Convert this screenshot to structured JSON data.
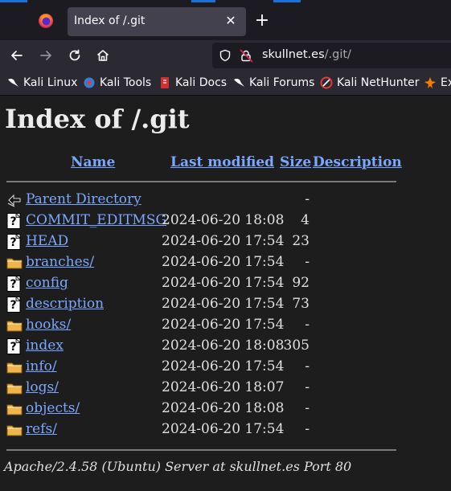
{
  "browser": {
    "tab_title": "Index of /.git",
    "tab_close": "✕",
    "new_tab": "+",
    "url_host": "skullnet.es",
    "url_path": "/.git/"
  },
  "bookmarks": [
    {
      "label": "Kali Linux",
      "icon": "kali-dragon-icon",
      "color": "#fbfbfe"
    },
    {
      "label": "Kali Tools",
      "icon": "kali-tools-icon",
      "color": "#3a7bd5"
    },
    {
      "label": "Kali Docs",
      "icon": "kali-docs-icon",
      "color": "#d32f2f"
    },
    {
      "label": "Kali Forums",
      "icon": "kali-dragon-icon",
      "color": "#fbfbfe"
    },
    {
      "label": "Kali NetHunter",
      "icon": "nethunter-icon",
      "color": "#e53935"
    },
    {
      "label": "Ex",
      "icon": "exploit-db-icon",
      "color": "#f57c00"
    }
  ],
  "page": {
    "title": "Index of /.git",
    "columns": {
      "name": "Name",
      "last_modified": "Last modified",
      "size": "Size",
      "description": "Description"
    },
    "rows": [
      {
        "name": "Parent Directory",
        "modified": "",
        "size": "-",
        "icon": "back-arrow-icon"
      },
      {
        "name": "COMMIT_EDITMSG",
        "modified": "2024-06-20 18:08",
        "size": "4",
        "icon": "unknown-file-icon"
      },
      {
        "name": "HEAD",
        "modified": "2024-06-20 17:54",
        "size": "23",
        "icon": "unknown-file-icon"
      },
      {
        "name": "branches/",
        "modified": "2024-06-20 17:54",
        "size": "-",
        "icon": "folder-icon"
      },
      {
        "name": "config",
        "modified": "2024-06-20 17:54",
        "size": "92",
        "icon": "unknown-file-icon"
      },
      {
        "name": "description",
        "modified": "2024-06-20 17:54",
        "size": "73",
        "icon": "unknown-file-icon"
      },
      {
        "name": "hooks/",
        "modified": "2024-06-20 17:54",
        "size": "-",
        "icon": "folder-icon"
      },
      {
        "name": "index",
        "modified": "2024-06-20 18:08",
        "size": "305",
        "icon": "unknown-file-icon"
      },
      {
        "name": "info/",
        "modified": "2024-06-20 17:54",
        "size": "-",
        "icon": "folder-icon"
      },
      {
        "name": "logs/",
        "modified": "2024-06-20 18:07",
        "size": "-",
        "icon": "folder-icon"
      },
      {
        "name": "objects/",
        "modified": "2024-06-20 18:08",
        "size": "-",
        "icon": "folder-icon"
      },
      {
        "name": "refs/",
        "modified": "2024-06-20 17:54",
        "size": "-",
        "icon": "folder-icon"
      }
    ],
    "footer": "Apache/2.4.58 (Ubuntu) Server at skullnet.es Port 80"
  },
  "colors": {
    "link": "#7aa7ff",
    "page_bg": "#1d1d1d",
    "folder": "#f0b44c"
  }
}
